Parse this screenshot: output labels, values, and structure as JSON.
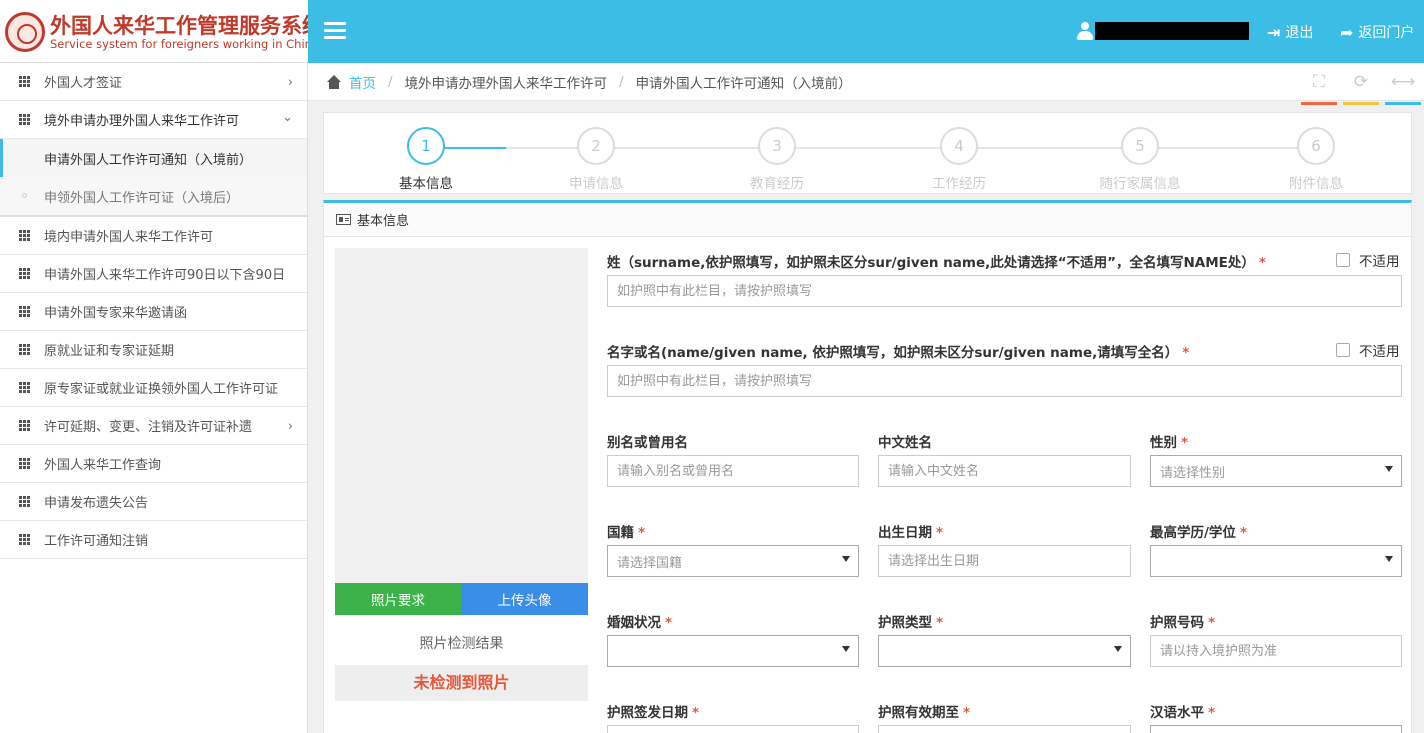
{
  "header": {
    "logo_cn": "外国人来华工作管理服务系统",
    "logo_en": "Service system for foreigners working in China",
    "logout_label": "退出",
    "portal_label": "返回门户"
  },
  "sidebar": {
    "items": [
      {
        "label": "外国人才签证",
        "chevron": "›"
      },
      {
        "label": "境外申请办理外国人来华工作许可",
        "chevron": "⌄"
      },
      {
        "label": "境内申请外国人来华工作许可"
      },
      {
        "label": "申请外国人来华工作许可90日以下含90日"
      },
      {
        "label": "申请外国专家来华邀请函"
      },
      {
        "label": "原就业证和专家证延期"
      },
      {
        "label": "原专家证或就业证换领外国人工作许可证"
      },
      {
        "label": "许可延期、变更、注销及许可证补遗",
        "chevron": "›"
      },
      {
        "label": "外国人来华工作查询"
      },
      {
        "label": "申请发布遗失公告"
      },
      {
        "label": "工作许可通知注销"
      }
    ],
    "sub_items": [
      {
        "label": "申请外国人工作许可通知（入境前）"
      },
      {
        "label": "申领外国人工作许可证（入境后）"
      }
    ]
  },
  "breadcrumb": {
    "home": "首页",
    "sep": "/",
    "level1": "境外申请办理外国人来华工作许可",
    "level2": "申请外国人工作许可通知（入境前）"
  },
  "toolbar": {
    "fullscreen_icon": "⛶",
    "refresh_icon": "⟳",
    "arrows_icon": "⟷"
  },
  "steps": [
    {
      "num": "1",
      "label": "基本信息"
    },
    {
      "num": "2",
      "label": "申请信息"
    },
    {
      "num": "3",
      "label": "教育经历"
    },
    {
      "num": "4",
      "label": "工作经历"
    },
    {
      "num": "5",
      "label": "随行家属信息"
    },
    {
      "num": "6",
      "label": "附件信息"
    }
  ],
  "panel": {
    "title": "基本信息",
    "photo_req_button": "照片要求",
    "upload_button": "上传头像",
    "check_title": "照片检测结果",
    "check_result": "未检测到照片",
    "required_mark": "*",
    "not_applicable": "不适用"
  },
  "form": {
    "surname": {
      "label": "姓（surname,依护照填写，如护照未区分sur/given name,此处请选择“不适用”，全名填写NAME处）",
      "placeholder": "如护照中有此栏目，请按护照填写"
    },
    "given_name": {
      "label": "名字或名(name/given name, 依护照填写，如护照未区分sur/given name,请填写全名）",
      "placeholder": "如护照中有此栏目，请按护照填写"
    },
    "alias": {
      "label": "别名或曾用名",
      "placeholder": "请输入别名或曾用名"
    },
    "chinese_name": {
      "label": "中文姓名",
      "placeholder": "请输入中文姓名"
    },
    "gender": {
      "label": "性别",
      "value": "请选择性别"
    },
    "nationality": {
      "label": "国籍",
      "value": "请选择国籍"
    },
    "birth_date": {
      "label": "出生日期",
      "placeholder": "请选择出生日期"
    },
    "education": {
      "label": "最高学历/学位",
      "value": ""
    },
    "marital": {
      "label": "婚姻状况",
      "value": ""
    },
    "passport_type": {
      "label": "护照类型",
      "value": ""
    },
    "passport_no": {
      "label": "护照号码",
      "placeholder": "请以持入境护照为准"
    },
    "passport_issue": {
      "label": "护照签发日期"
    },
    "passport_expiry": {
      "label": "护照有效期至"
    },
    "chinese_level": {
      "label": "汉语水平"
    }
  }
}
